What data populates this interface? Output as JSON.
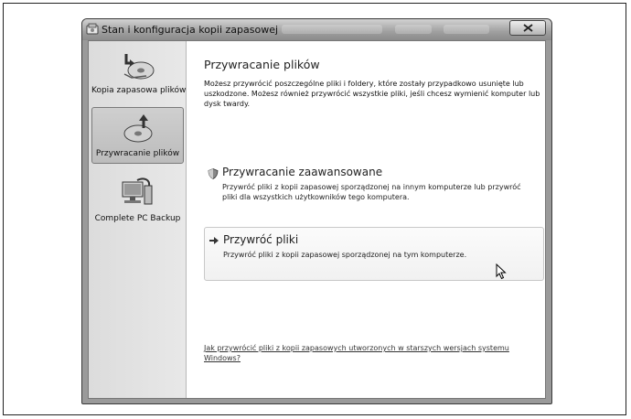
{
  "window": {
    "title": "Stan i konfiguracja kopii zapasowej",
    "close_label": "×"
  },
  "sidebar": {
    "items": [
      {
        "label": "Kopia zapasowa plików",
        "icon": "backup-disk-icon"
      },
      {
        "label": "Przywracanie plików",
        "icon": "restore-disk-icon",
        "selected": true
      },
      {
        "label": "Complete PC Backup",
        "icon": "pc-backup-icon"
      }
    ]
  },
  "main": {
    "heading": "Przywracanie plików",
    "description": "Możesz przywrócić poszczególne pliki i foldery, które zostały przypadkowo usunięte lub uszkodzone. Możesz również przywrócić wszystkie pliki, jeśli chcesz wymienić komputer lub dysk twardy.",
    "options": [
      {
        "title": "Przywracanie zaawansowane",
        "description": "Przywróć pliki z kopii zapasowej sporządzonej na innym komputerze lub przywróć pliki dla wszystkich użytkowników tego komputera.",
        "icon": "shield-icon"
      },
      {
        "title": "Przywróć pliki",
        "description": "Przywróć pliki z kopii zapasowej sporządzonej na tym komputerze.",
        "icon": "arrow-right-icon"
      }
    ],
    "help_link": "Jak przywrócić pliki z kopii zapasowych utworzonych w starszych wersjach systemu Windows?"
  }
}
